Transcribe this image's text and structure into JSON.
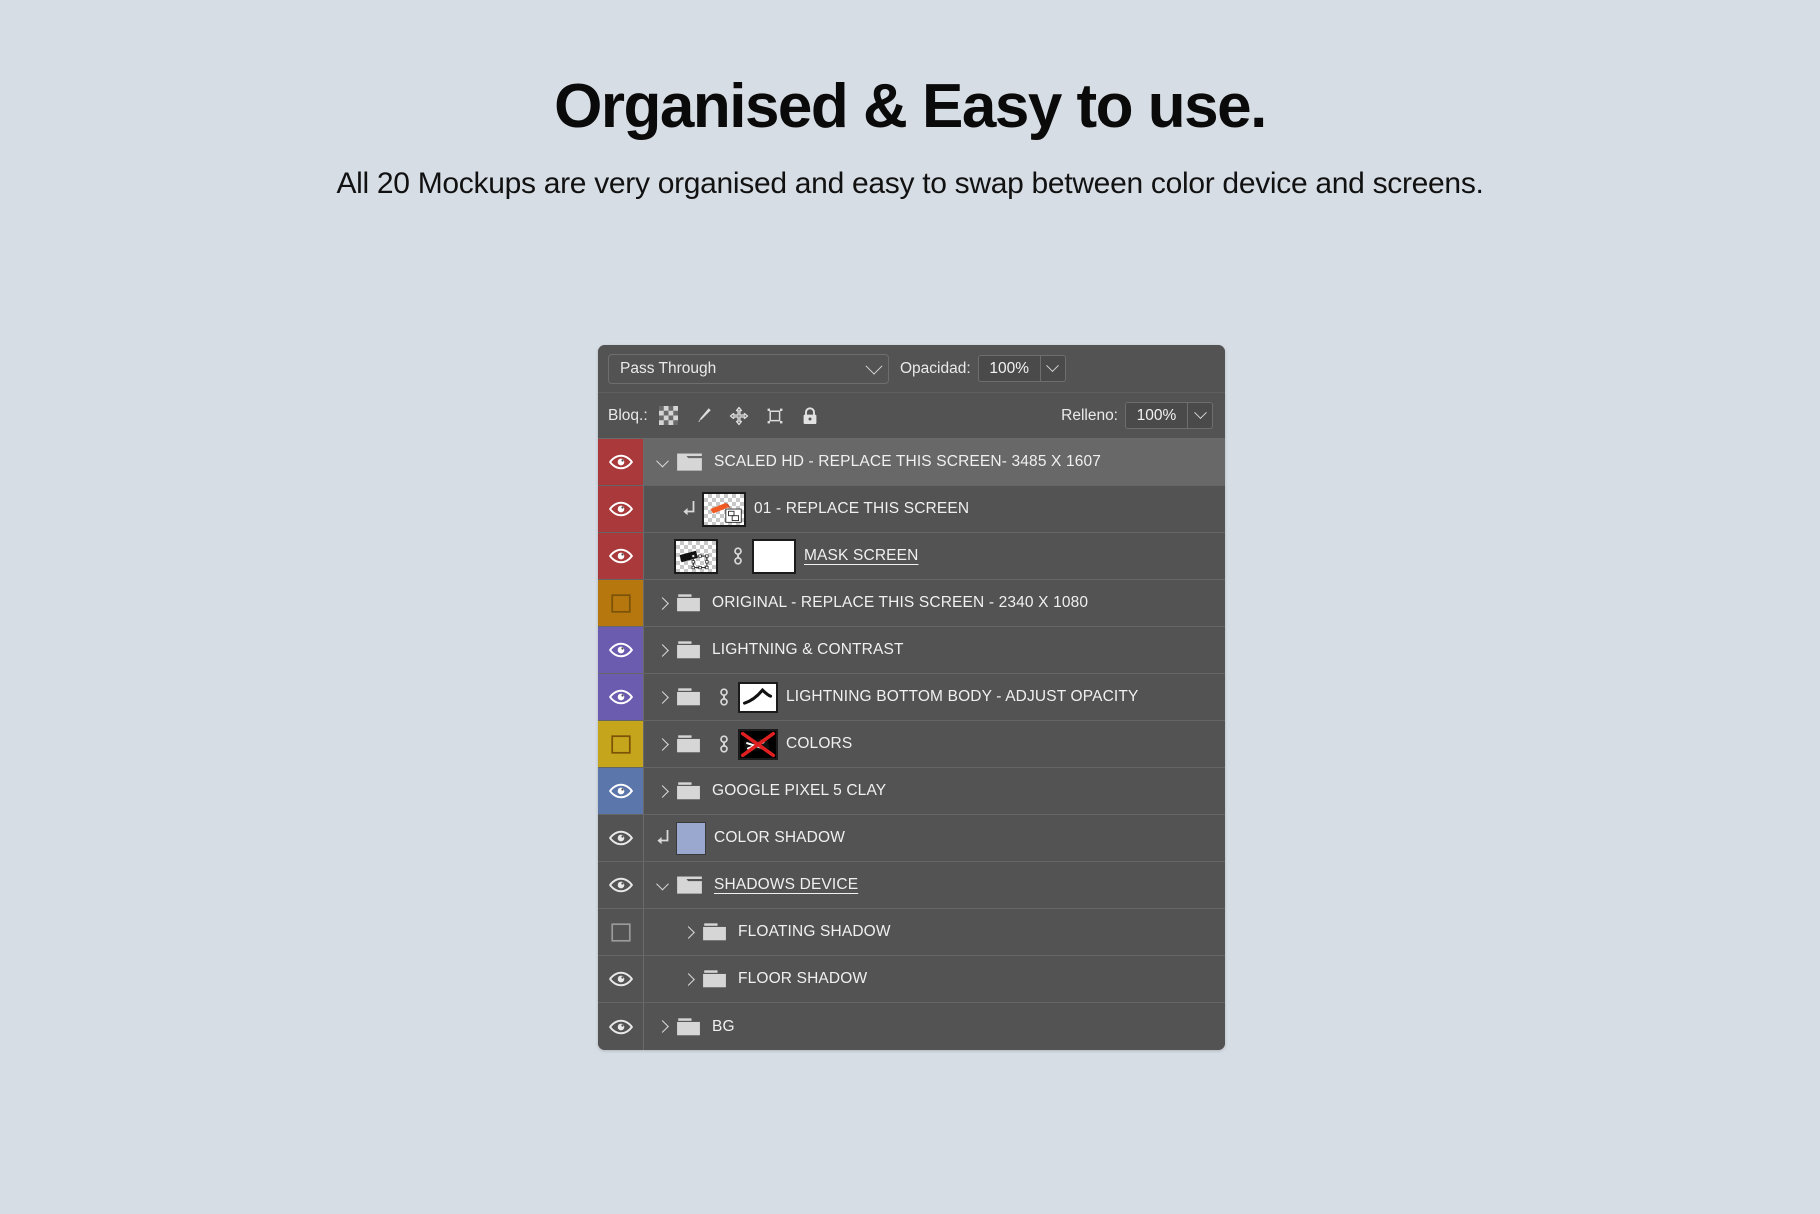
{
  "headline": "Organised & Easy to use.",
  "subhead": "All 20 Mockups are very organised and easy to swap between color device and screens.",
  "panel": {
    "blend_mode": "Pass Through",
    "opacity_label": "Opacidad:",
    "opacity_value": "100%",
    "lock_label": "Bloq.:",
    "fill_label": "Relleno:",
    "fill_value": "100%",
    "lock_icons": [
      "transparency-lock-icon",
      "brush-lock-icon",
      "move-lock-icon",
      "artboard-lock-icon",
      "lock-all-icon"
    ]
  },
  "layers": [
    {
      "name": "SCALED HD - REPLACE THIS SCREEN- 3485 X 1607",
      "color": "#a9393a",
      "visible": true,
      "selected": true,
      "twisty": "open",
      "kind": "group",
      "indent": 0,
      "underline": false
    },
    {
      "name": "01 - REPLACE THIS SCREEN",
      "color": "#a9393a",
      "visible": true,
      "selected": false,
      "twisty": "none",
      "kind": "clipped",
      "indent": 0,
      "underline": false
    },
    {
      "name": "MASK SCREEN",
      "color": "#a9393a",
      "visible": true,
      "selected": false,
      "twisty": "none",
      "kind": "masked",
      "indent": 0,
      "underline": true
    },
    {
      "name": "ORIGINAL - REPLACE THIS SCREEN - 2340 X 1080",
      "color": "#b6770f",
      "visible": false,
      "selected": false,
      "twisty": "closed",
      "kind": "group",
      "indent": 0,
      "underline": false
    },
    {
      "name": "LIGHTNING & CONTRAST",
      "color": "#6c5cb0",
      "visible": true,
      "selected": false,
      "twisty": "closed",
      "kind": "group",
      "indent": 0,
      "underline": false
    },
    {
      "name": "LIGHTNING BOTTOM BODY - ADJUST OPACITY",
      "color": "#6c5cb0",
      "visible": true,
      "selected": false,
      "twisty": "closed",
      "kind": "group-mask-curve",
      "indent": 0,
      "underline": false
    },
    {
      "name": "COLORS",
      "color": "#c4a51c",
      "visible": false,
      "selected": false,
      "twisty": "closed",
      "kind": "group-mask-x",
      "indent": 0,
      "underline": false
    },
    {
      "name": "GOOGLE PIXEL 5 CLAY",
      "color": "#5a76ab",
      "visible": true,
      "selected": false,
      "twisty": "closed",
      "kind": "group",
      "indent": 0,
      "underline": false
    },
    {
      "name": "COLOR SHADOW",
      "color": "",
      "visible": true,
      "selected": false,
      "twisty": "none",
      "kind": "clipped-solid",
      "indent": 0,
      "underline": false
    },
    {
      "name": "SHADOWS DEVICE",
      "color": "",
      "visible": true,
      "selected": false,
      "twisty": "open",
      "kind": "group",
      "indent": 0,
      "underline": true
    },
    {
      "name": "FLOATING SHADOW",
      "color": "",
      "visible": false,
      "selected": false,
      "twisty": "closed",
      "kind": "group",
      "indent": 1,
      "underline": false
    },
    {
      "name": "FLOOR SHADOW",
      "color": "",
      "visible": true,
      "selected": false,
      "twisty": "closed",
      "kind": "group",
      "indent": 1,
      "underline": false
    },
    {
      "name": "BG",
      "color": "",
      "visible": true,
      "selected": false,
      "twisty": "closed",
      "kind": "group",
      "indent": 0,
      "underline": false
    }
  ],
  "colors": {
    "page_background": "#d7dde5",
    "panel_background": "#535353",
    "row_selected": "#686868",
    "label_red": "#a9393a",
    "label_orange": "#b6770f",
    "label_violet": "#6c5cb0",
    "label_yellow": "#c4a51c",
    "label_blue": "#5a76ab",
    "label_none": "#6e6e6e",
    "solid_swatch": "#9aa8d0"
  }
}
